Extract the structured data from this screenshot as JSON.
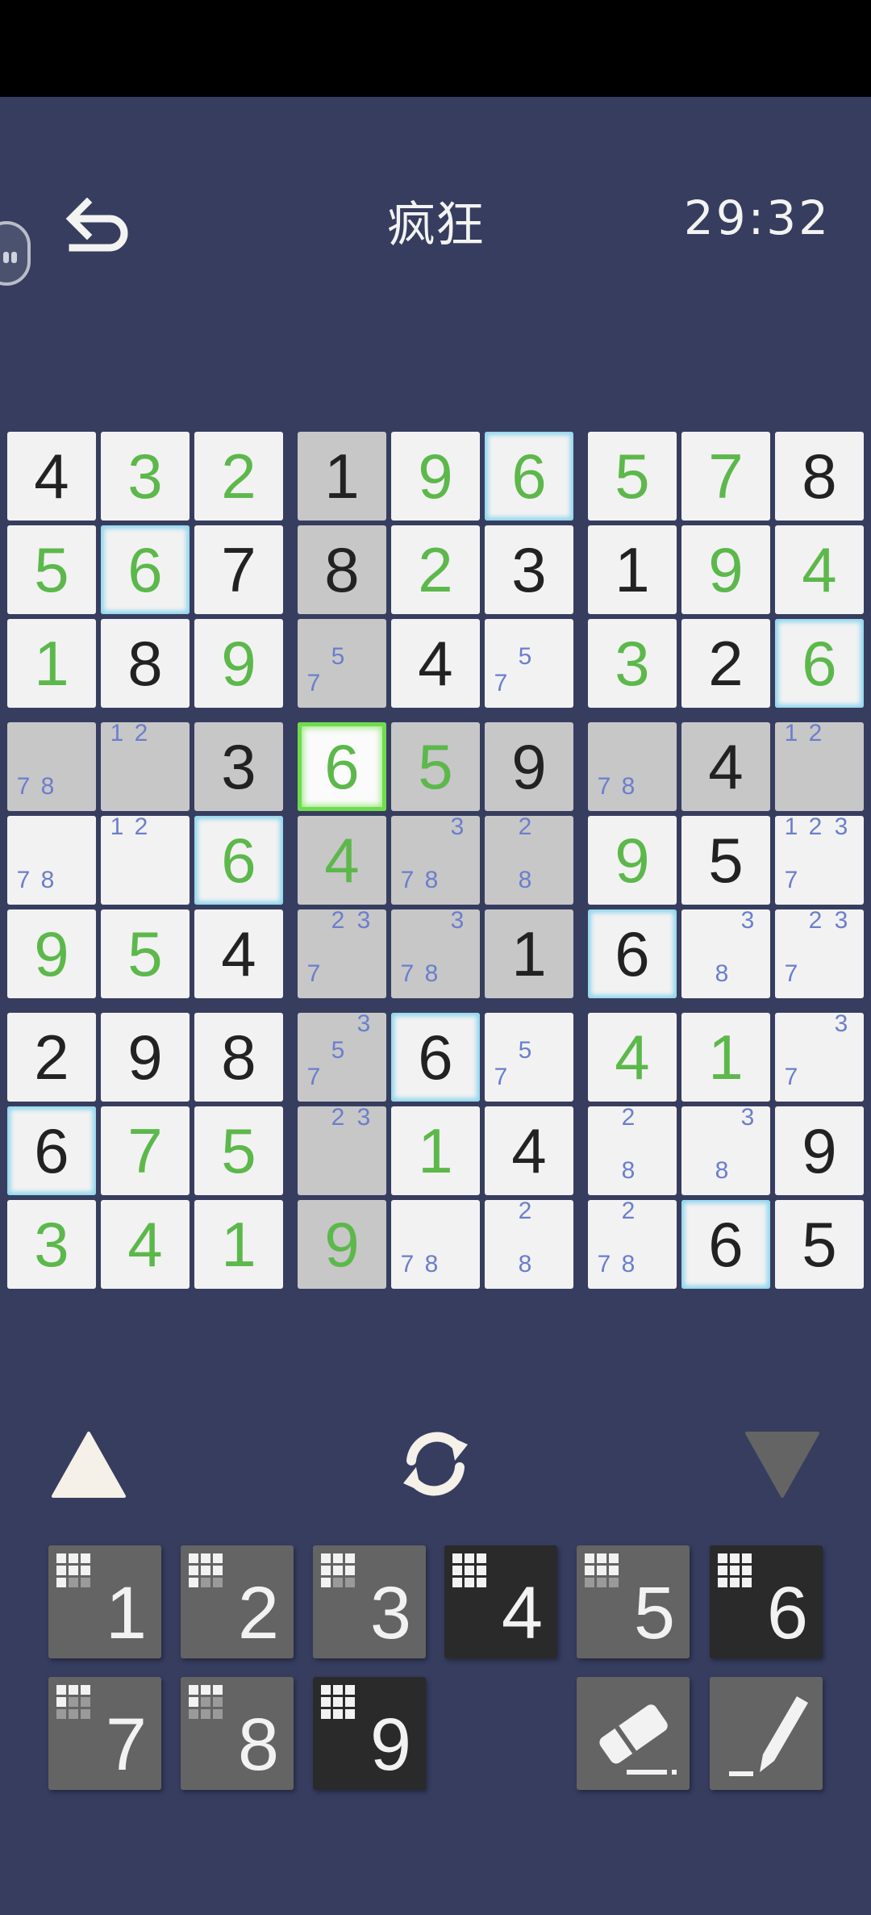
{
  "header": {
    "title": "疯狂",
    "timer": "29:32"
  },
  "board": {
    "rows": [
      [
        {
          "v": "4",
          "t": "given"
        },
        {
          "v": "3",
          "t": "user"
        },
        {
          "v": "2",
          "t": "user"
        },
        {
          "v": "1",
          "t": "given",
          "shade": true
        },
        {
          "v": "9",
          "t": "user"
        },
        {
          "v": "6",
          "t": "user",
          "glow": true
        },
        {
          "v": "5",
          "t": "user"
        },
        {
          "v": "7",
          "t": "user"
        },
        {
          "v": "8",
          "t": "given"
        }
      ],
      [
        {
          "v": "5",
          "t": "user"
        },
        {
          "v": "6",
          "t": "user",
          "glow": true
        },
        {
          "v": "7",
          "t": "given"
        },
        {
          "v": "8",
          "t": "given",
          "shade": true
        },
        {
          "v": "2",
          "t": "user"
        },
        {
          "v": "3",
          "t": "given"
        },
        {
          "v": "1",
          "t": "given"
        },
        {
          "v": "9",
          "t": "user"
        },
        {
          "v": "4",
          "t": "user"
        }
      ],
      [
        {
          "v": "1",
          "t": "user"
        },
        {
          "v": "8",
          "t": "given"
        },
        {
          "v": "9",
          "t": "user"
        },
        {
          "notes": [
            "5",
            "7"
          ],
          "shade": true
        },
        {
          "v": "4",
          "t": "given"
        },
        {
          "notes": [
            "5",
            "7"
          ]
        },
        {
          "v": "3",
          "t": "user"
        },
        {
          "v": "2",
          "t": "given"
        },
        {
          "v": "6",
          "t": "user",
          "glow": true
        }
      ],
      [
        {
          "notes": [
            "7",
            "8"
          ],
          "shade": true
        },
        {
          "notes": [
            "1",
            "2"
          ],
          "shade": true
        },
        {
          "v": "3",
          "t": "given",
          "shade": true
        },
        {
          "v": "6",
          "t": "user",
          "selected": true
        },
        {
          "v": "5",
          "t": "user",
          "shade": true
        },
        {
          "v": "9",
          "t": "given",
          "shade": true
        },
        {
          "notes": [
            "7",
            "8"
          ],
          "shade": true
        },
        {
          "v": "4",
          "t": "given",
          "shade": true
        },
        {
          "notes": [
            "1",
            "2"
          ],
          "shade": true
        }
      ],
      [
        {
          "notes": [
            "7",
            "8"
          ]
        },
        {
          "notes": [
            "1",
            "2"
          ]
        },
        {
          "v": "6",
          "t": "user",
          "glow": true
        },
        {
          "v": "4",
          "t": "user",
          "shade": true
        },
        {
          "notes": [
            "3",
            "7",
            "8"
          ],
          "shade": true
        },
        {
          "notes": [
            "2",
            "8"
          ],
          "shade": true
        },
        {
          "v": "9",
          "t": "user"
        },
        {
          "v": "5",
          "t": "given"
        },
        {
          "notes": [
            "1",
            "2",
            "3",
            "7"
          ]
        }
      ],
      [
        {
          "v": "9",
          "t": "user"
        },
        {
          "v": "5",
          "t": "user"
        },
        {
          "v": "4",
          "t": "given"
        },
        {
          "notes": [
            "2",
            "3",
            "7"
          ],
          "shade": true
        },
        {
          "notes": [
            "3",
            "7",
            "8"
          ],
          "shade": true
        },
        {
          "v": "1",
          "t": "given",
          "shade": true
        },
        {
          "v": "6",
          "t": "given",
          "glow": true
        },
        {
          "notes": [
            "3",
            "8"
          ]
        },
        {
          "notes": [
            "2",
            "3",
            "7"
          ]
        }
      ],
      [
        {
          "v": "2",
          "t": "given"
        },
        {
          "v": "9",
          "t": "given"
        },
        {
          "v": "8",
          "t": "given"
        },
        {
          "notes": [
            "3",
            "5",
            "7"
          ],
          "shade": true
        },
        {
          "v": "6",
          "t": "given",
          "glow": true
        },
        {
          "notes": [
            "5",
            "7"
          ]
        },
        {
          "v": "4",
          "t": "user"
        },
        {
          "v": "1",
          "t": "user"
        },
        {
          "notes": [
            "3",
            "7"
          ]
        }
      ],
      [
        {
          "v": "6",
          "t": "given",
          "glow": true
        },
        {
          "v": "7",
          "t": "user"
        },
        {
          "v": "5",
          "t": "user"
        },
        {
          "notes": [
            "2",
            "3"
          ],
          "shade": true
        },
        {
          "v": "1",
          "t": "user"
        },
        {
          "v": "4",
          "t": "given"
        },
        {
          "notes": [
            "2",
            "8"
          ]
        },
        {
          "notes": [
            "3",
            "8"
          ]
        },
        {
          "v": "9",
          "t": "given"
        }
      ],
      [
        {
          "v": "3",
          "t": "user"
        },
        {
          "v": "4",
          "t": "user"
        },
        {
          "v": "1",
          "t": "user"
        },
        {
          "v": "9",
          "t": "user",
          "shade": true
        },
        {
          "notes": [
            "7",
            "8"
          ]
        },
        {
          "notes": [
            "2",
            "8"
          ]
        },
        {
          "notes": [
            "2",
            "7",
            "8"
          ]
        },
        {
          "v": "6",
          "t": "given",
          "glow": true
        },
        {
          "v": "5",
          "t": "given"
        }
      ]
    ]
  },
  "controls": {
    "up_icon": "triangle-up-icon",
    "refresh_icon": "refresh-icon",
    "down_icon": "triangle-down-icon"
  },
  "keypad": [
    {
      "label": "1",
      "dark": false,
      "remaining": 2
    },
    {
      "label": "2",
      "dark": false,
      "remaining": 2
    },
    {
      "label": "3",
      "dark": false,
      "remaining": 2
    },
    {
      "label": "4",
      "dark": true,
      "remaining": 0
    },
    {
      "label": "5",
      "dark": false,
      "remaining": 3
    },
    {
      "label": "6",
      "dark": true,
      "remaining": 0
    },
    {
      "label": "7",
      "dark": false,
      "remaining": 5
    },
    {
      "label": "8",
      "dark": false,
      "remaining": 5
    },
    {
      "label": "9",
      "dark": true,
      "remaining": 0
    }
  ],
  "tools": {
    "eraser_icon": "eraser-icon",
    "pencil_icon": "pencil-icon"
  },
  "colors": {
    "background": "#363d5f",
    "user_digit": "#5cb84b",
    "given_digit": "#222222",
    "note_digit": "#6a7fcc",
    "highlight_glow": "#8fd6ee",
    "selected_border": "#6fdc4e"
  }
}
